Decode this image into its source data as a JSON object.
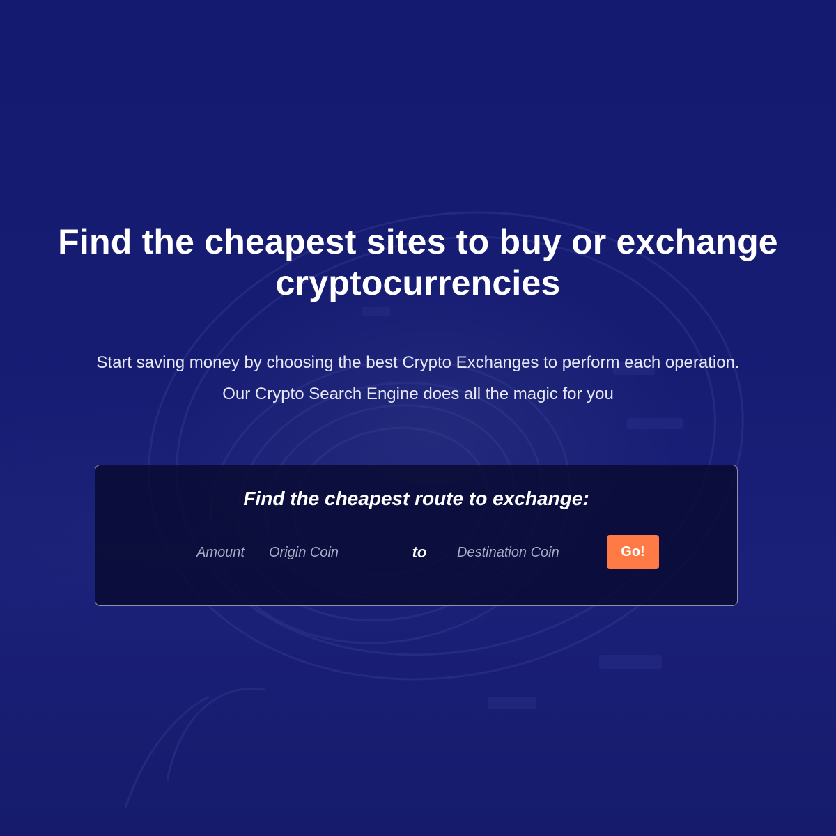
{
  "hero": {
    "headline": "Find the cheapest sites to buy or exchange cryptocurrencies",
    "subtext_line1": "Start saving money by choosing the best Crypto Exchanges to perform each operation.",
    "subtext_line2": "Our Crypto Search Engine does all the magic for you"
  },
  "search": {
    "title": "Find the cheapest route to exchange:",
    "amount_placeholder": "Amount",
    "amount_value": "",
    "origin_placeholder": "Origin Coin",
    "origin_value": "",
    "to_label": "to",
    "destination_placeholder": "Destination Coin",
    "destination_value": "",
    "go_label": "Go!"
  },
  "colors": {
    "background": "#151a6e",
    "card_background": "#080a30",
    "accent": "#ff7a45",
    "text": "#ffffff"
  },
  "background_image": "coin-illustration"
}
